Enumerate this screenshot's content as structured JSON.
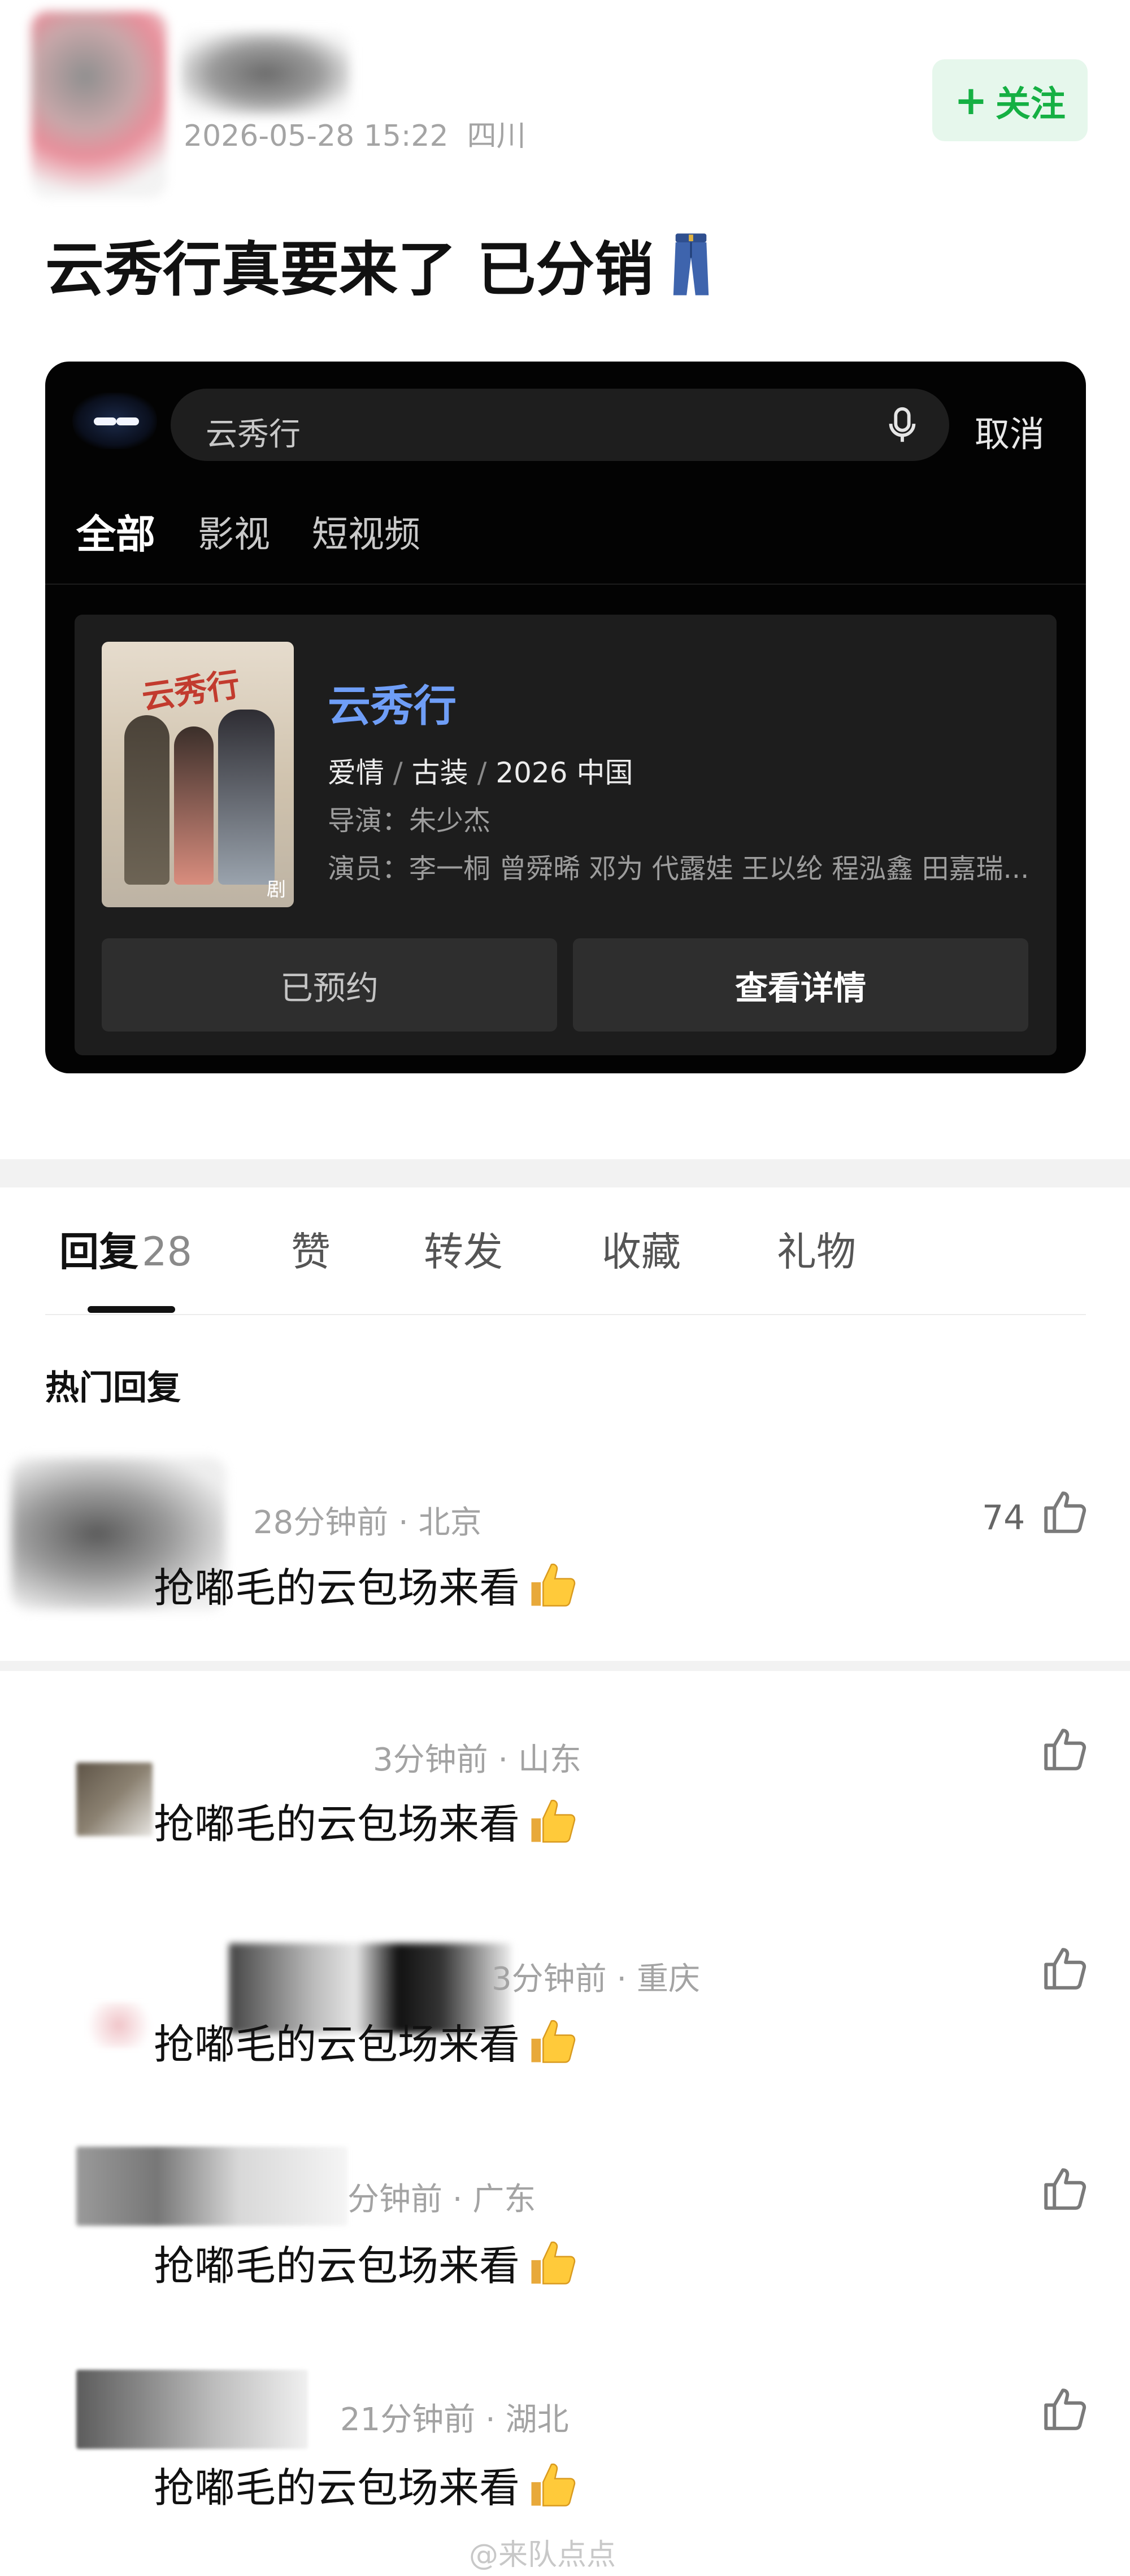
{
  "post": {
    "date": "2026-05-28 15:22",
    "location": "四川",
    "follow_label": "关注",
    "title": "云秀行真要来了 已分销"
  },
  "card": {
    "search_value": "云秀行",
    "cancel_label": "取消",
    "tabs": [
      "全部",
      "影视",
      "短视频"
    ],
    "result": {
      "title": "云秀行",
      "poster_badge": "剧",
      "tag1": "爱情",
      "tag2": "古装",
      "tag3": "2026 中国",
      "director": "导演：朱少杰",
      "cast": "演员：李一桐 曾舜晞 邓为 代露娃 王以纶 程泓鑫 田嘉瑞..."
    },
    "btn_reserved": "已预约",
    "btn_detail": "查看详情"
  },
  "tabs": {
    "reply_label": "回复",
    "reply_count": "28",
    "like_label": "赞",
    "repost_label": "转发",
    "fav_label": "收藏",
    "gift_label": "礼物"
  },
  "hot_label": "热门回复",
  "comments": [
    {
      "meta": "28分钟前 · 北京",
      "text": "抢嘟毛的云包场来看",
      "likes": "74"
    },
    {
      "meta": "3分钟前 · 山东",
      "text": "抢嘟毛的云包场来看"
    },
    {
      "meta": "3分钟前 · 重庆",
      "text": "抢嘟毛的云包场来看"
    },
    {
      "meta": "分钟前 · 广东",
      "text": "抢嘟毛的云包场来看"
    },
    {
      "meta": "21分钟前 · 湖北",
      "text": "抢嘟毛的云包场来看"
    }
  ],
  "watermark": "@来队点点"
}
